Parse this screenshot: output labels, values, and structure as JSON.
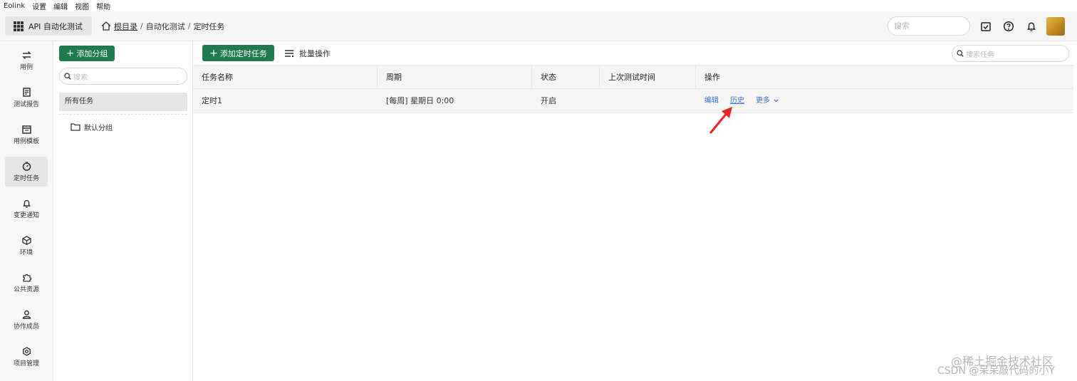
{
  "menubar": {
    "items": [
      "Eolink",
      "设置",
      "编辑",
      "视图",
      "帮助"
    ]
  },
  "header": {
    "app_name": "API 自动化测试",
    "breadcrumb": {
      "home": "根目录",
      "sep1": "/",
      "level1": "自动化测试",
      "sep2": "/",
      "level2": "定时任务"
    },
    "search_placeholder": "搜索"
  },
  "sidebar": {
    "items": [
      {
        "label": "用例",
        "icon": "swap-icon"
      },
      {
        "label": "测试报告",
        "icon": "report-icon"
      },
      {
        "label": "用例模板",
        "icon": "template-icon"
      },
      {
        "label": "定时任务",
        "icon": "timer-icon",
        "active": true
      },
      {
        "label": "变更通知",
        "icon": "bell-icon"
      },
      {
        "label": "环境",
        "icon": "cube-icon"
      },
      {
        "label": "公共资源",
        "icon": "puzzle-icon"
      },
      {
        "label": "协作成员",
        "icon": "user-icon"
      },
      {
        "label": "项目管理",
        "icon": "gear-icon"
      }
    ]
  },
  "groups": {
    "add_label": "添加分组",
    "search_placeholder": "搜索",
    "all_tasks": "所有任务",
    "default_group": "默认分组"
  },
  "main": {
    "add_task_label": "添加定时任务",
    "batch_label": "批量操作",
    "search_placeholder": "搜索任务",
    "columns": [
      "任务名称",
      "周期",
      "状态",
      "上次测试时间",
      "操作"
    ],
    "rows": [
      {
        "name": "定时1",
        "cycle": "[每周] 星期日 0:00",
        "status": "开启",
        "last_run": "",
        "actions": {
          "edit": "编辑",
          "history": "历史",
          "more": "更多"
        }
      }
    ]
  },
  "watermark": {
    "line1": "@稀土掘金技术社区",
    "line2": "CSDN @呆呆敲代码的小Y"
  },
  "colors": {
    "primary_green": "#1f7a4e",
    "link_blue": "#3b73d6",
    "arrow_red": "#e8262a"
  }
}
